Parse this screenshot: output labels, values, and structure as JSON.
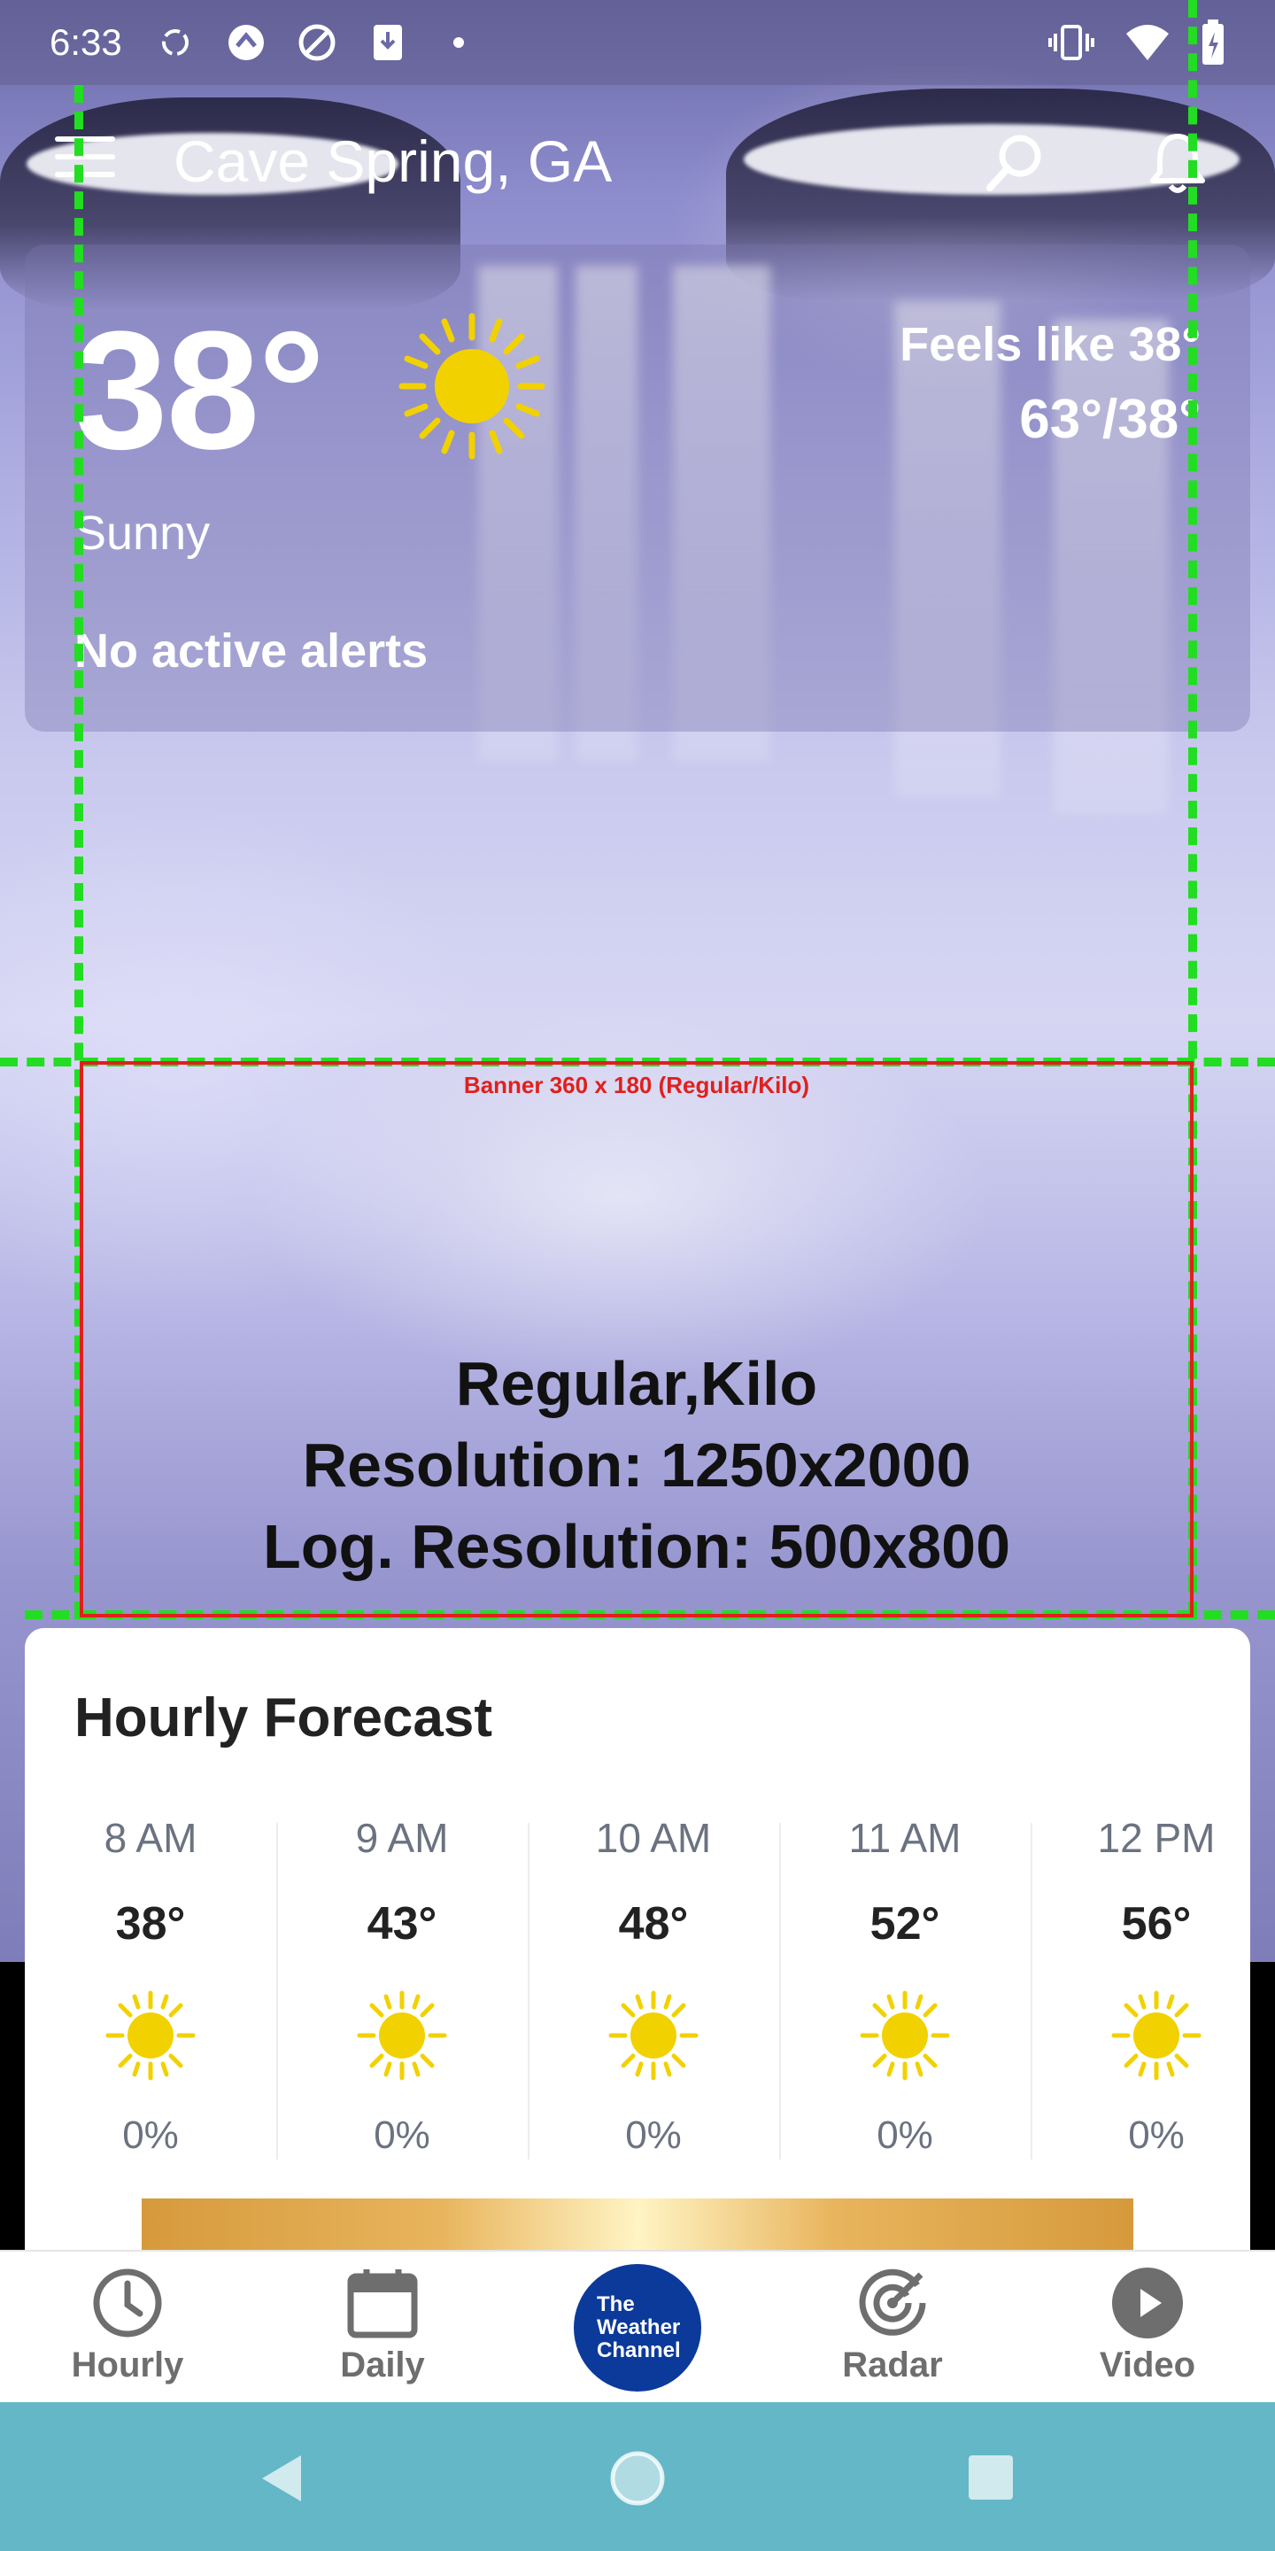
{
  "status_bar": {
    "time": "6:33"
  },
  "app_bar": {
    "location": "Cave Spring, GA"
  },
  "current": {
    "temperature": "38°",
    "condition": "Sunny",
    "alerts": "No active alerts",
    "feels_like": "Feels like 38°",
    "hi_lo": "63°/38°"
  },
  "banner": {
    "label": "Banner 360 x 180 (Regular/Kilo)",
    "line1": "Regular,Kilo",
    "line2": "Resolution: 1250x2000",
    "line3": "Log. Resolution: 500x800"
  },
  "hourly": {
    "title": "Hourly Forecast",
    "hours": [
      {
        "time": "8 AM",
        "temp": "38°",
        "precip": "0%",
        "icon": "sun-icon"
      },
      {
        "time": "9 AM",
        "temp": "43°",
        "precip": "0%",
        "icon": "sun-icon"
      },
      {
        "time": "10 AM",
        "temp": "48°",
        "precip": "0%",
        "icon": "sun-icon"
      },
      {
        "time": "11 AM",
        "temp": "52°",
        "precip": "0%",
        "icon": "sun-icon"
      },
      {
        "time": "12 PM",
        "temp": "56°",
        "precip": "0%",
        "icon": "sun-icon"
      }
    ]
  },
  "bottom_nav": {
    "items": [
      {
        "label": "Hourly",
        "icon": "clock-icon"
      },
      {
        "label": "Daily",
        "icon": "calendar-icon"
      },
      {
        "label": "The Weather Channel",
        "icon": "twc-logo"
      },
      {
        "label": "Radar",
        "icon": "radar-icon"
      },
      {
        "label": "Video",
        "icon": "play-icon"
      }
    ],
    "logo_lines": [
      "The",
      "Weather",
      "Channel"
    ]
  },
  "colors": {
    "accent_blue": "#0b3a9b",
    "sun_yellow": "#f2d100",
    "guide_green": "#22dd22",
    "banner_red": "#e0201c",
    "system_nav": "#63b7c6"
  }
}
